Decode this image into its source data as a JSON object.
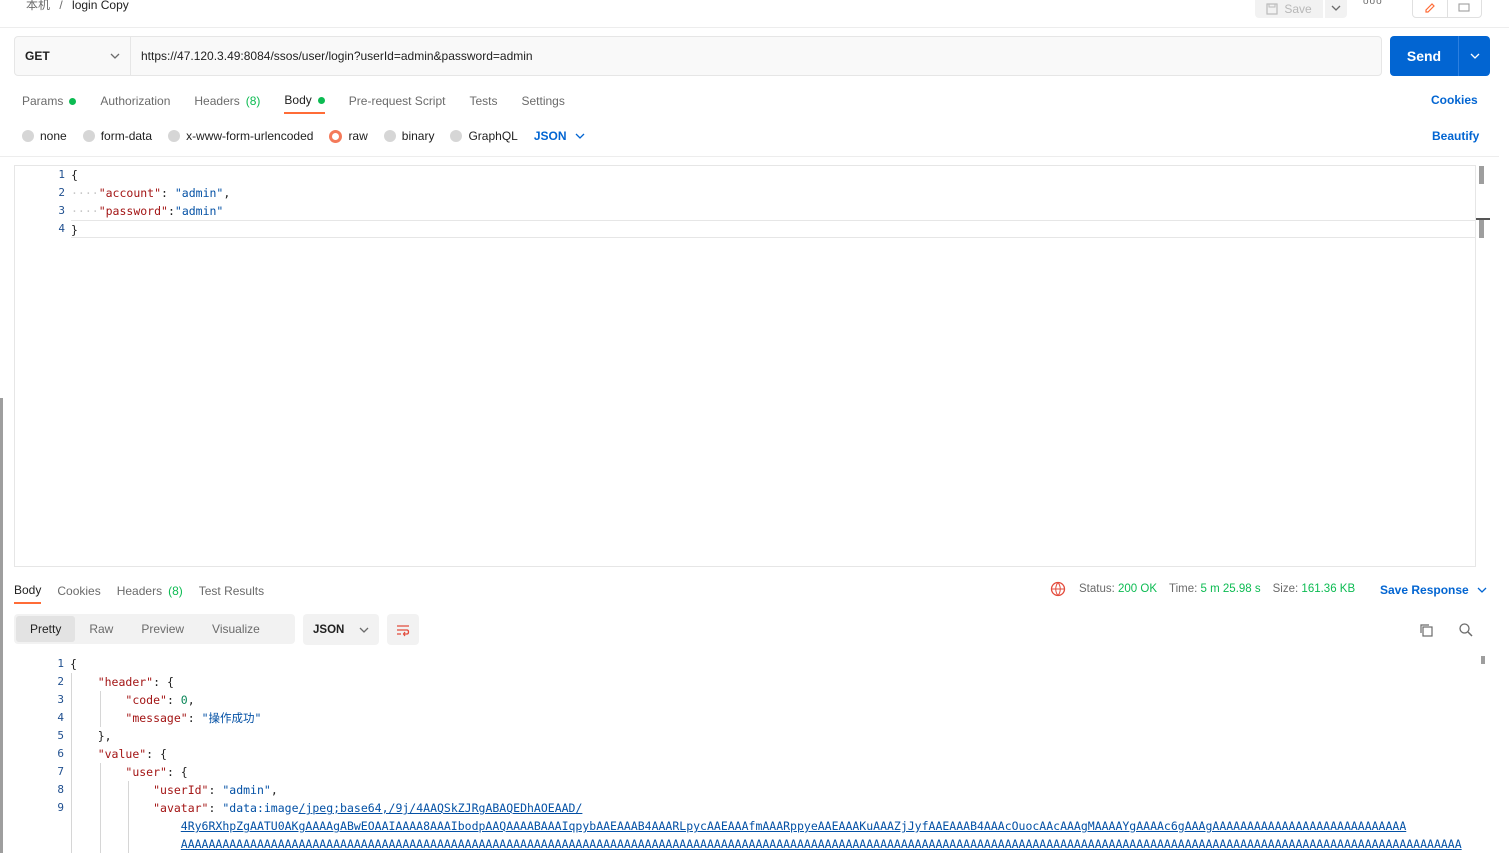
{
  "breadcrumb": {
    "parent": "本机",
    "separator": "/",
    "current": "login Copy"
  },
  "toolbar": {
    "save_label": "Save",
    "more_label": "ooo"
  },
  "request": {
    "method": "GET",
    "url": "https://47.120.3.49:8084/ssos/user/login?userId=admin&password=admin",
    "send_label": "Send"
  },
  "request_tabs": {
    "params": "Params",
    "authorization": "Authorization",
    "headers": "Headers",
    "headers_count": "(8)",
    "body": "Body",
    "pre_request": "Pre-request Script",
    "tests": "Tests",
    "settings": "Settings",
    "cookies": "Cookies"
  },
  "body_options": {
    "none": "none",
    "form_data": "form-data",
    "urlencoded": "x-www-form-urlencoded",
    "raw": "raw",
    "binary": "binary",
    "graphql": "GraphQL",
    "language": "JSON",
    "beautify": "Beautify"
  },
  "request_body": {
    "line_numbers": [
      "1",
      "2",
      "3",
      "4"
    ],
    "open": "{",
    "account_key": "\"account\"",
    "account_val": "\"admin\"",
    "password_key": "\"password\"",
    "password_val": "\"admin\"",
    "close": "}"
  },
  "response_tabs": {
    "body": "Body",
    "cookies": "Cookies",
    "headers": "Headers",
    "headers_count": "(8)",
    "test_results": "Test Results"
  },
  "response_status": {
    "status_label": "Status:",
    "status_value": "200 OK",
    "time_label": "Time:",
    "time_value": "5 m 25.98 s",
    "size_label": "Size:",
    "size_value": "161.36 KB",
    "save_response": "Save Response"
  },
  "response_view": {
    "pretty": "Pretty",
    "raw": "Raw",
    "preview": "Preview",
    "visualize": "Visualize",
    "format": "JSON"
  },
  "response_body": {
    "line_numbers": [
      "1",
      "2",
      "3",
      "4",
      "5",
      "6",
      "7",
      "8",
      "9",
      ""
    ],
    "l1": "{",
    "header_key": "\"header\"",
    "code_key": "\"code\"",
    "code_val": "0",
    "message_key": "\"message\"",
    "message_val": "\"操作成功\"",
    "l5": "},",
    "value_key": "\"value\"",
    "user_key": "\"user\"",
    "userid_key": "\"userId\"",
    "userid_val": "\"admin\"",
    "avatar_key": "\"avatar\"",
    "avatar_prefix": "\"data:image",
    "avatar_link": "/jpeg;base64,/9j/4AAQSkZJRgABAQEDhAOEAAD/",
    "avatar_cont1": "4Ry6RXhpZgAATU0AKgAAAAgABwEOAAIAAAA8AAAIbodpAAQAAAABAAAIqpybAAEAAAB4AAARLpycAAEAAAfmAAARppyeAAEAAAKuAAAZjJyfAAEAAAB4AAAcOuocAAcAAAgMAAAAYgAAAAc6gAAAgAAAAAAAAAAAAAAAAAAAAAAAAAAAA",
    "avatar_cont2": "AAAAAAAAAAAAAAAAAAAAAAAAAAAAAAAAAAAAAAAAAAAAAAAAAAAAAAAAAAAAAAAAAAAAAAAAAAAAAAAAAAAAAAAAAAAAAAAAAAAAAAAAAAAAAAAAAAAAAAAAAAAAAAAAAAAAAAAAAAAAAAAAAAAAAAAAAAAAAAAAAAAAAAAAAAAAAAAAAAAAAAAAA"
  },
  "colors": {
    "accent": "#ff6c37",
    "primary": "#0265d2",
    "success": "#0cbb52"
  }
}
